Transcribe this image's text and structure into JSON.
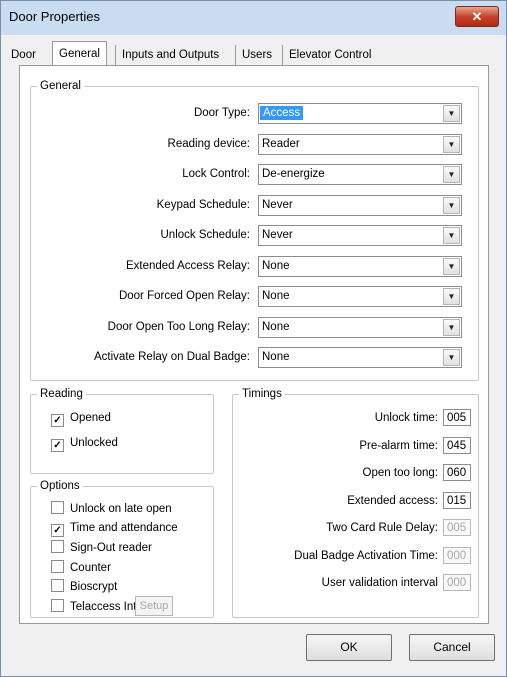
{
  "window": {
    "title": "Door Properties",
    "close_label": "✕"
  },
  "tabs": [
    {
      "label": "Door"
    },
    {
      "label": "General"
    },
    {
      "label": "Inputs and Outputs"
    },
    {
      "label": "Users"
    },
    {
      "label": "Elevator Control"
    }
  ],
  "active_tab": "General",
  "general": {
    "legend": "General",
    "fields": [
      {
        "label": "Door Type:",
        "value": "Access"
      },
      {
        "label": "Reading device:",
        "value": "Reader"
      },
      {
        "label": "Lock Control:",
        "value": "De-energize"
      },
      {
        "label": "Keypad Schedule:",
        "value": "Never"
      },
      {
        "label": "Unlock Schedule:",
        "value": "Never"
      },
      {
        "label": "Extended Access Relay:",
        "value": "None"
      },
      {
        "label": "Door Forced Open Relay:",
        "value": "None"
      },
      {
        "label": "Door Open Too Long Relay:",
        "value": "None"
      },
      {
        "label": "Activate Relay on Dual Badge:",
        "value": "None"
      }
    ]
  },
  "reading": {
    "legend": "Reading",
    "items": [
      {
        "label": "Opened",
        "checked": true
      },
      {
        "label": "Unlocked",
        "checked": true
      }
    ]
  },
  "options": {
    "legend": "Options",
    "items": [
      {
        "label": "Unlock on late open",
        "checked": false
      },
      {
        "label": "Time and attendance",
        "checked": true
      },
      {
        "label": "Sign-Out reader",
        "checked": false
      },
      {
        "label": "Counter",
        "checked": false
      },
      {
        "label": "Bioscrypt",
        "checked": false
      },
      {
        "label": "Telaccess Intercom",
        "checked": false
      }
    ],
    "setup_label": "Setup"
  },
  "timings": {
    "legend": "Timings",
    "items": [
      {
        "label": "Unlock time:",
        "value": "005",
        "enabled": true
      },
      {
        "label": "Pre-alarm time:",
        "value": "045",
        "enabled": true
      },
      {
        "label": "Open too long:",
        "value": "060",
        "enabled": true
      },
      {
        "label": "Extended access:",
        "value": "015",
        "enabled": true
      },
      {
        "label": "Two Card Rule Delay:",
        "value": "005",
        "enabled": false
      },
      {
        "label": "Dual Badge Activation Time:",
        "value": "000",
        "enabled": false
      },
      {
        "label": "User validation interval",
        "value": "000",
        "enabled": false
      }
    ]
  },
  "buttons": {
    "ok": "OK",
    "cancel": "Cancel"
  },
  "colors": {
    "selection": "#3399ff",
    "titlebar": "#c9dcf1",
    "close": "#c7432b"
  }
}
